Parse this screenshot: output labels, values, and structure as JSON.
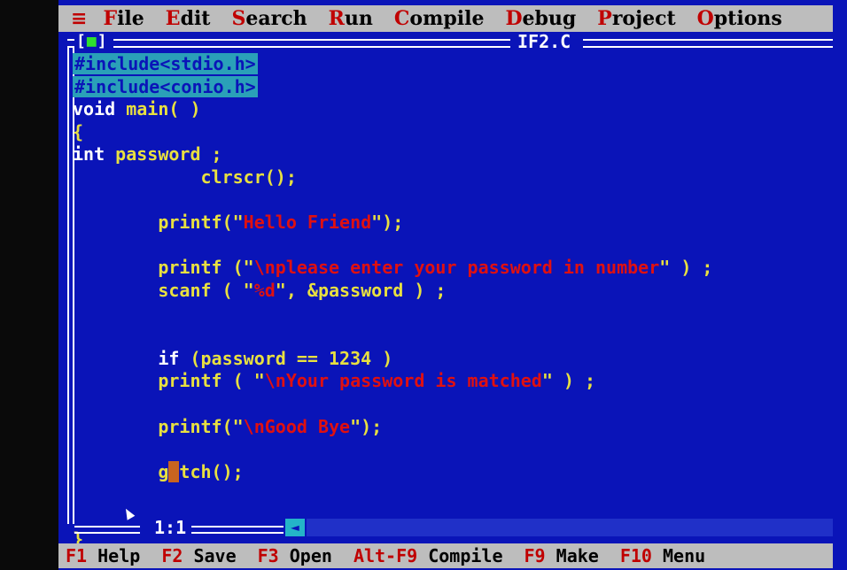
{
  "menu": {
    "system_icon": "≡",
    "items": [
      {
        "hotkey": "F",
        "rest": "ile"
      },
      {
        "hotkey": "E",
        "rest": "dit"
      },
      {
        "hotkey": "S",
        "rest": "earch"
      },
      {
        "hotkey": "R",
        "rest": "un"
      },
      {
        "hotkey": "C",
        "rest": "ompile"
      },
      {
        "hotkey": "D",
        "rest": "ebug"
      },
      {
        "hotkey": "P",
        "rest": "roject"
      },
      {
        "hotkey": "O",
        "rest": "ptions"
      }
    ]
  },
  "editor": {
    "title": "IF2.C",
    "close_box": "[■]",
    "cursor_position": "1:1",
    "lines": [
      {
        "segments": [
          {
            "t": "#include<stdio.h>",
            "c": "inc"
          }
        ]
      },
      {
        "segments": [
          {
            "t": "#include<conio.h>",
            "c": "inc"
          }
        ]
      },
      {
        "segments": [
          {
            "t": "void",
            "c": "kw"
          },
          {
            "t": " main( )",
            "c": "plain"
          }
        ]
      },
      {
        "segments": [
          {
            "t": "{",
            "c": "plain"
          }
        ]
      },
      {
        "segments": [
          {
            "t": "int",
            "c": "kw"
          },
          {
            "t": " password ;",
            "c": "plain"
          }
        ]
      },
      {
        "segments": [
          {
            "t": "            clrscr();",
            "c": "plain"
          }
        ]
      },
      {
        "segments": []
      },
      {
        "segments": [
          {
            "t": "        printf(\"",
            "c": "plain"
          },
          {
            "t": "Hello Friend",
            "c": "str"
          },
          {
            "t": "\");",
            "c": "plain"
          }
        ]
      },
      {
        "segments": []
      },
      {
        "segments": [
          {
            "t": "        printf (\"",
            "c": "plain"
          },
          {
            "t": "\\nplease enter your password in number",
            "c": "str"
          },
          {
            "t": "\" ) ;",
            "c": "plain"
          }
        ]
      },
      {
        "segments": [
          {
            "t": "        scanf ( \"",
            "c": "plain"
          },
          {
            "t": "%d",
            "c": "str"
          },
          {
            "t": "\", &password ) ;",
            "c": "plain"
          }
        ]
      },
      {
        "segments": []
      },
      {
        "segments": []
      },
      {
        "segments": [
          {
            "t": "        ",
            "c": "plain"
          },
          {
            "t": "if",
            "c": "kw"
          },
          {
            "t": " (password == 1234 )",
            "c": "plain"
          }
        ]
      },
      {
        "segments": [
          {
            "t": "        printf ( \"",
            "c": "plain"
          },
          {
            "t": "\\nYour password is matched",
            "c": "str"
          },
          {
            "t": "\" ) ;",
            "c": "plain"
          }
        ]
      },
      {
        "segments": []
      },
      {
        "segments": [
          {
            "t": "        printf(\"",
            "c": "plain"
          },
          {
            "t": "\\nGood Bye",
            "c": "str"
          },
          {
            "t": "\");",
            "c": "plain"
          }
        ]
      },
      {
        "segments": []
      },
      {
        "segments": [
          {
            "t": "        g",
            "c": "plain"
          },
          {
            "t": "e",
            "c": "cur"
          },
          {
            "t": "tch();",
            "c": "plain"
          }
        ]
      },
      {
        "segments": []
      },
      {
        "segments": []
      },
      {
        "segments": [
          {
            "t": "}",
            "c": "plain"
          }
        ]
      }
    ]
  },
  "help": [
    {
      "key": "F1",
      "label": "Help"
    },
    {
      "key": "F2",
      "label": "Save"
    },
    {
      "key": "F3",
      "label": "Open"
    },
    {
      "key": "Alt-F9",
      "label": "Compile"
    },
    {
      "key": "F9",
      "label": "Make"
    },
    {
      "key": "F10",
      "label": "Menu"
    }
  ],
  "colors": {
    "editor_bg": "#0a14b8",
    "code_text": "#e8e040",
    "keyword": "#ffffff",
    "string": "#e01010",
    "include_highlight": "#2aa0b8",
    "menu_bg": "#bdbdbd",
    "hotkey": "#c00000"
  }
}
